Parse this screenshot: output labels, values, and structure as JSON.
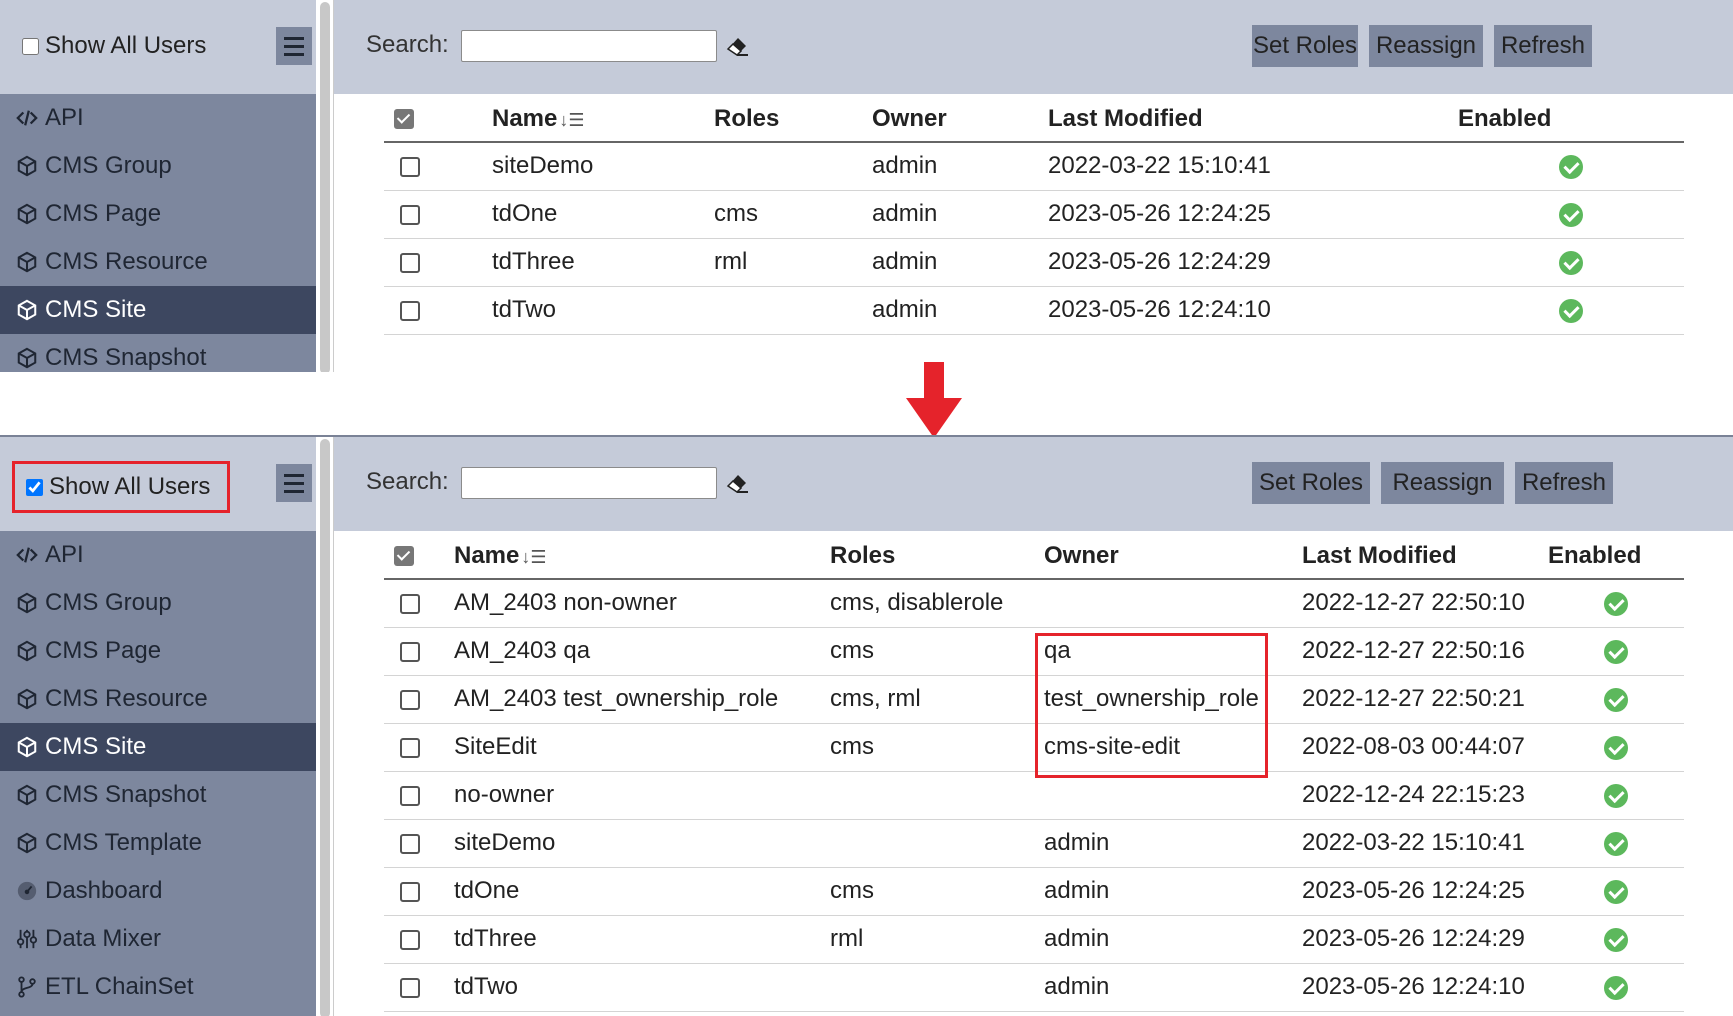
{
  "before": {
    "show_all_users": {
      "label": "Show All Users",
      "checked": false
    },
    "sidebar": {
      "items": [
        {
          "label": "API",
          "icon": "code-icon"
        },
        {
          "label": "CMS Group",
          "icon": "cube-icon"
        },
        {
          "label": "CMS Page",
          "icon": "cube-icon"
        },
        {
          "label": "CMS Resource",
          "icon": "cube-icon"
        },
        {
          "label": "CMS Site",
          "icon": "cube-icon",
          "active": true
        },
        {
          "label": "CMS Snapshot",
          "icon": "cube-icon"
        }
      ]
    },
    "toolbar": {
      "search_label": "Search:",
      "search_value": "",
      "set_roles": "Set Roles",
      "reassign": "Reassign",
      "refresh": "Refresh"
    },
    "table": {
      "headers": {
        "name": "Name",
        "roles": "Roles",
        "owner": "Owner",
        "last_modified": "Last Modified",
        "enabled": "Enabled"
      },
      "rows": [
        {
          "name": "siteDemo",
          "roles": "",
          "owner": "admin",
          "modified": "2022-03-22 15:10:41",
          "enabled": true
        },
        {
          "name": "tdOne",
          "roles": "cms",
          "owner": "admin",
          "modified": "2023-05-26 12:24:25",
          "enabled": true
        },
        {
          "name": "tdThree",
          "roles": "rml",
          "owner": "admin",
          "modified": "2023-05-26 12:24:29",
          "enabled": true
        },
        {
          "name": "tdTwo",
          "roles": "",
          "owner": "admin",
          "modified": "2023-05-26 12:24:10",
          "enabled": true
        }
      ]
    }
  },
  "after": {
    "show_all_users": {
      "label": "Show All Users",
      "checked": true
    },
    "sidebar": {
      "items": [
        {
          "label": "API",
          "icon": "code-icon"
        },
        {
          "label": "CMS Group",
          "icon": "cube-icon"
        },
        {
          "label": "CMS Page",
          "icon": "cube-icon"
        },
        {
          "label": "CMS Resource",
          "icon": "cube-icon"
        },
        {
          "label": "CMS Site",
          "icon": "cube-icon",
          "active": true
        },
        {
          "label": "CMS Snapshot",
          "icon": "cube-icon"
        },
        {
          "label": "CMS Template",
          "icon": "cube-icon"
        },
        {
          "label": "Dashboard",
          "icon": "dashboard-icon"
        },
        {
          "label": "Data Mixer",
          "icon": "sliders-icon"
        },
        {
          "label": "ETL ChainSet",
          "icon": "branch-icon"
        }
      ]
    },
    "toolbar": {
      "search_label": "Search:",
      "search_value": "",
      "set_roles": "Set Roles",
      "reassign": "Reassign",
      "refresh": "Refresh"
    },
    "table": {
      "headers": {
        "name": "Name",
        "roles": "Roles",
        "owner": "Owner",
        "last_modified": "Last Modified",
        "enabled": "Enabled"
      },
      "rows": [
        {
          "name": "AM_2403 non-owner",
          "roles": "cms, disablerole",
          "owner": "",
          "modified": "2022-12-27 22:50:10",
          "enabled": true
        },
        {
          "name": "AM_2403 qa",
          "roles": "cms",
          "owner": "qa",
          "modified": "2022-12-27 22:50:16",
          "enabled": true
        },
        {
          "name": "AM_2403 test_ownership_role",
          "roles": "cms, rml",
          "owner": "test_ownership_role",
          "modified": "2022-12-27 22:50:21",
          "enabled": true
        },
        {
          "name": "SiteEdit",
          "roles": "cms",
          "owner": "cms-site-edit",
          "modified": "2022-08-03 00:44:07",
          "enabled": true
        },
        {
          "name": "no-owner",
          "roles": "",
          "owner": "",
          "modified": "2022-12-24 22:15:23",
          "enabled": true
        },
        {
          "name": "siteDemo",
          "roles": "",
          "owner": "admin",
          "modified": "2022-03-22 15:10:41",
          "enabled": true
        },
        {
          "name": "tdOne",
          "roles": "cms",
          "owner": "admin",
          "modified": "2023-05-26 12:24:25",
          "enabled": true
        },
        {
          "name": "tdThree",
          "roles": "rml",
          "owner": "admin",
          "modified": "2023-05-26 12:24:29",
          "enabled": true
        },
        {
          "name": "tdTwo",
          "roles": "",
          "owner": "admin",
          "modified": "2023-05-26 12:24:10",
          "enabled": true
        }
      ]
    }
  },
  "colors": {
    "highlight": "#e5232b",
    "sidebar": "#7d879e",
    "sidebar_active": "#3d4760",
    "toolbar": "#c5cbd9",
    "enabled": "#5cb85c"
  }
}
